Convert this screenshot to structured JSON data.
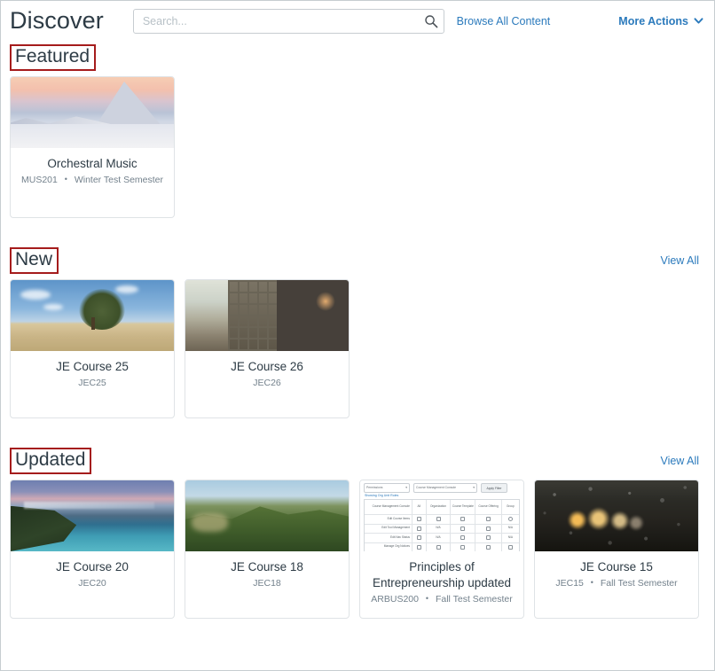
{
  "header": {
    "title": "Discover",
    "search": {
      "placeholder": "Search...",
      "value": "",
      "icon": "search-icon"
    },
    "browse_all_label": "Browse All Content",
    "more_actions_label": "More Actions",
    "more_actions_icon": "chevron-down-icon"
  },
  "colors": {
    "link": "#2b7abc",
    "title_text": "#2d3b45",
    "subtitle_text": "#73818c",
    "card_border": "#dfe3e6",
    "page_border": "#c7cdd1",
    "annotation_red": "#a51c1c"
  },
  "sections": [
    {
      "id": "featured",
      "heading": "Featured",
      "heading_highlighted": true,
      "view_all_label": null,
      "cards": [
        {
          "title": "Orchestral Music",
          "course_code": "MUS201",
          "separator": "•",
          "term": "Winter Test Semester",
          "image": "snow-mountain-photo"
        }
      ]
    },
    {
      "id": "new",
      "heading": "New",
      "heading_highlighted": true,
      "view_all_label": "View All",
      "cards": [
        {
          "title": "JE Course 25",
          "course_code": "JEC25",
          "separator": null,
          "term": null,
          "image": "lone-tree-field-photo"
        },
        {
          "title": "JE Course 26",
          "course_code": "JEC26",
          "separator": null,
          "term": null,
          "image": "steel-bridge-photo"
        }
      ]
    },
    {
      "id": "updated",
      "heading": "Updated",
      "heading_highlighted": true,
      "view_all_label": "View All",
      "cards": [
        {
          "title": "JE Course 20",
          "course_code": "JEC20",
          "separator": null,
          "term": null,
          "image": "lake-shore-photo"
        },
        {
          "title": "JE Course 18",
          "course_code": "JEC18",
          "separator": null,
          "term": null,
          "image": "forest-hillside-photo"
        },
        {
          "title": "Principles of Entrepreneurship updated",
          "course_code": "ARBUS200",
          "separator": "•",
          "term": "Fall Test Semester",
          "image": "permissions-table-screenshot"
        },
        {
          "title": "JE Course 15",
          "course_code": "JEC15",
          "separator": "•",
          "term": "Fall Test Semester",
          "image": "rainy-window-photo"
        }
      ]
    }
  ],
  "screenshot_thumb": {
    "filter_select": "Permissions",
    "role_select": "Course Management Console",
    "apply_button": "Apply Filter",
    "link": "Showing Org Unit Roles",
    "columns": [
      "Course Management Console",
      "All",
      "Organization",
      "Course Template",
      "Course Offering",
      "Group"
    ],
    "rows": [
      {
        "label": "Edit Course Items",
        "cells": [
          "check",
          "check",
          "check",
          "check",
          "check"
        ]
      },
      {
        "label": "Edit Tool Management",
        "cells": [
          "box",
          "N/A",
          "box",
          "box",
          "N/A"
        ]
      },
      {
        "label": "Edit Nav Status",
        "cells": [
          "box",
          "N/A",
          "box",
          "box",
          "N/A"
        ]
      },
      {
        "label": "Manage Org Notices",
        "cells": [
          "box",
          "box",
          "box",
          "box",
          "box"
        ]
      }
    ]
  }
}
